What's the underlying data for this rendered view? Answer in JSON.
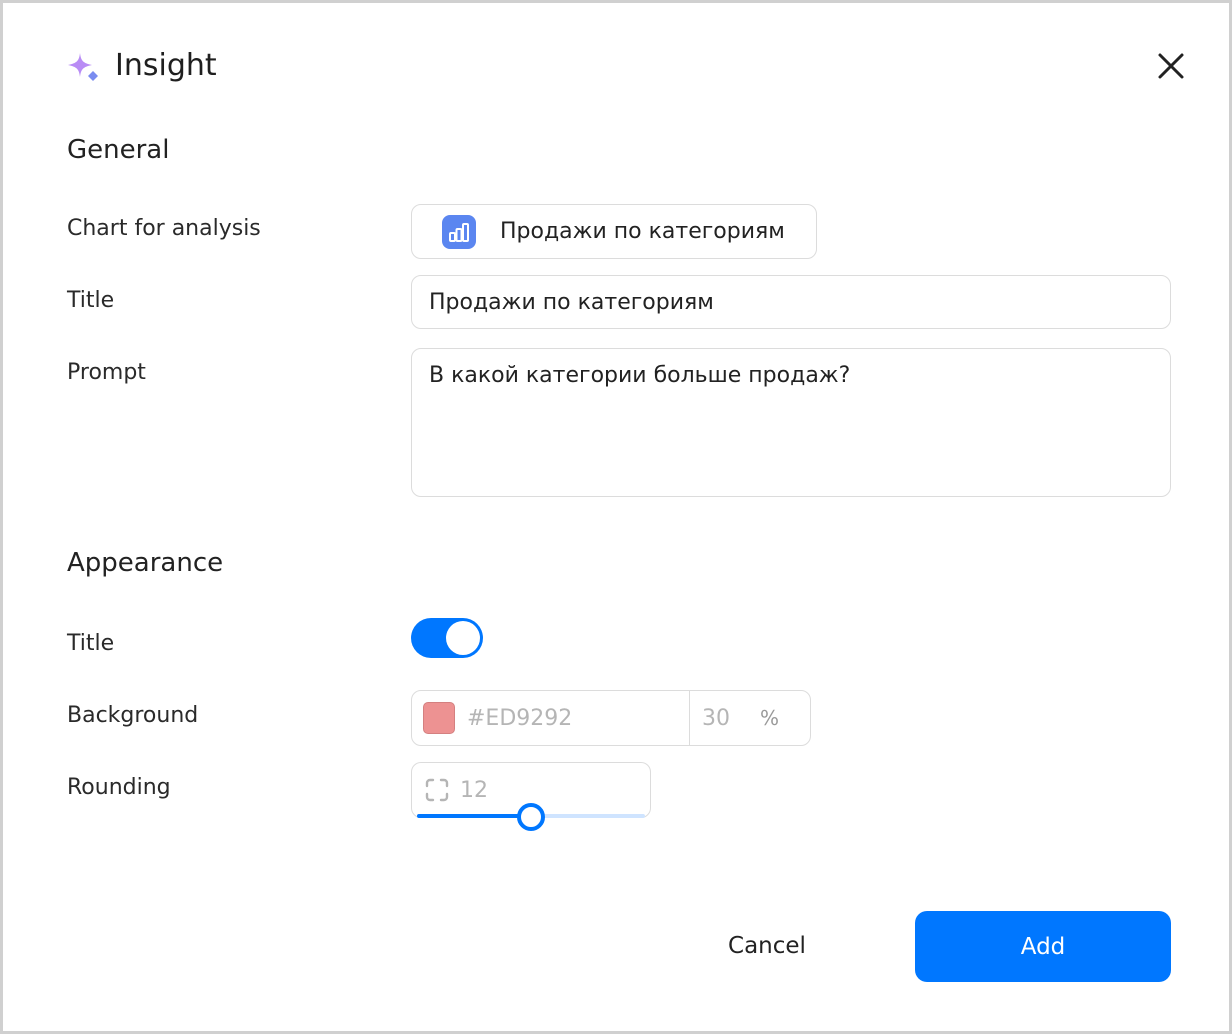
{
  "header": {
    "title": "Insight",
    "icon": "sparkle-icon",
    "close_icon": "close-icon"
  },
  "general": {
    "section_title": "General",
    "chart_label": "Chart for analysis",
    "chart_value": "Продажи по категориям",
    "chart_icon": "bar-chart-icon",
    "title_label": "Title",
    "title_value": "Продажи по категориям",
    "prompt_label": "Prompt",
    "prompt_value": "В какой категории больше продаж?"
  },
  "appearance": {
    "section_title": "Appearance",
    "title_label": "Title",
    "title_toggle_on": true,
    "background_label": "Background",
    "background_color": "#ED9292",
    "background_hex": "#ED9292",
    "background_opacity": "30",
    "opacity_unit": "%",
    "rounding_label": "Rounding",
    "rounding_icon": "corner-radius-icon",
    "rounding_value": "12"
  },
  "actions": {
    "cancel_label": "Cancel",
    "add_label": "Add"
  },
  "colors": {
    "accent": "#0077FF",
    "chart_badge": "#5B86F0",
    "sparkle_purple": "#B98CF5",
    "sparkle_blue": "#7A8CF0"
  }
}
